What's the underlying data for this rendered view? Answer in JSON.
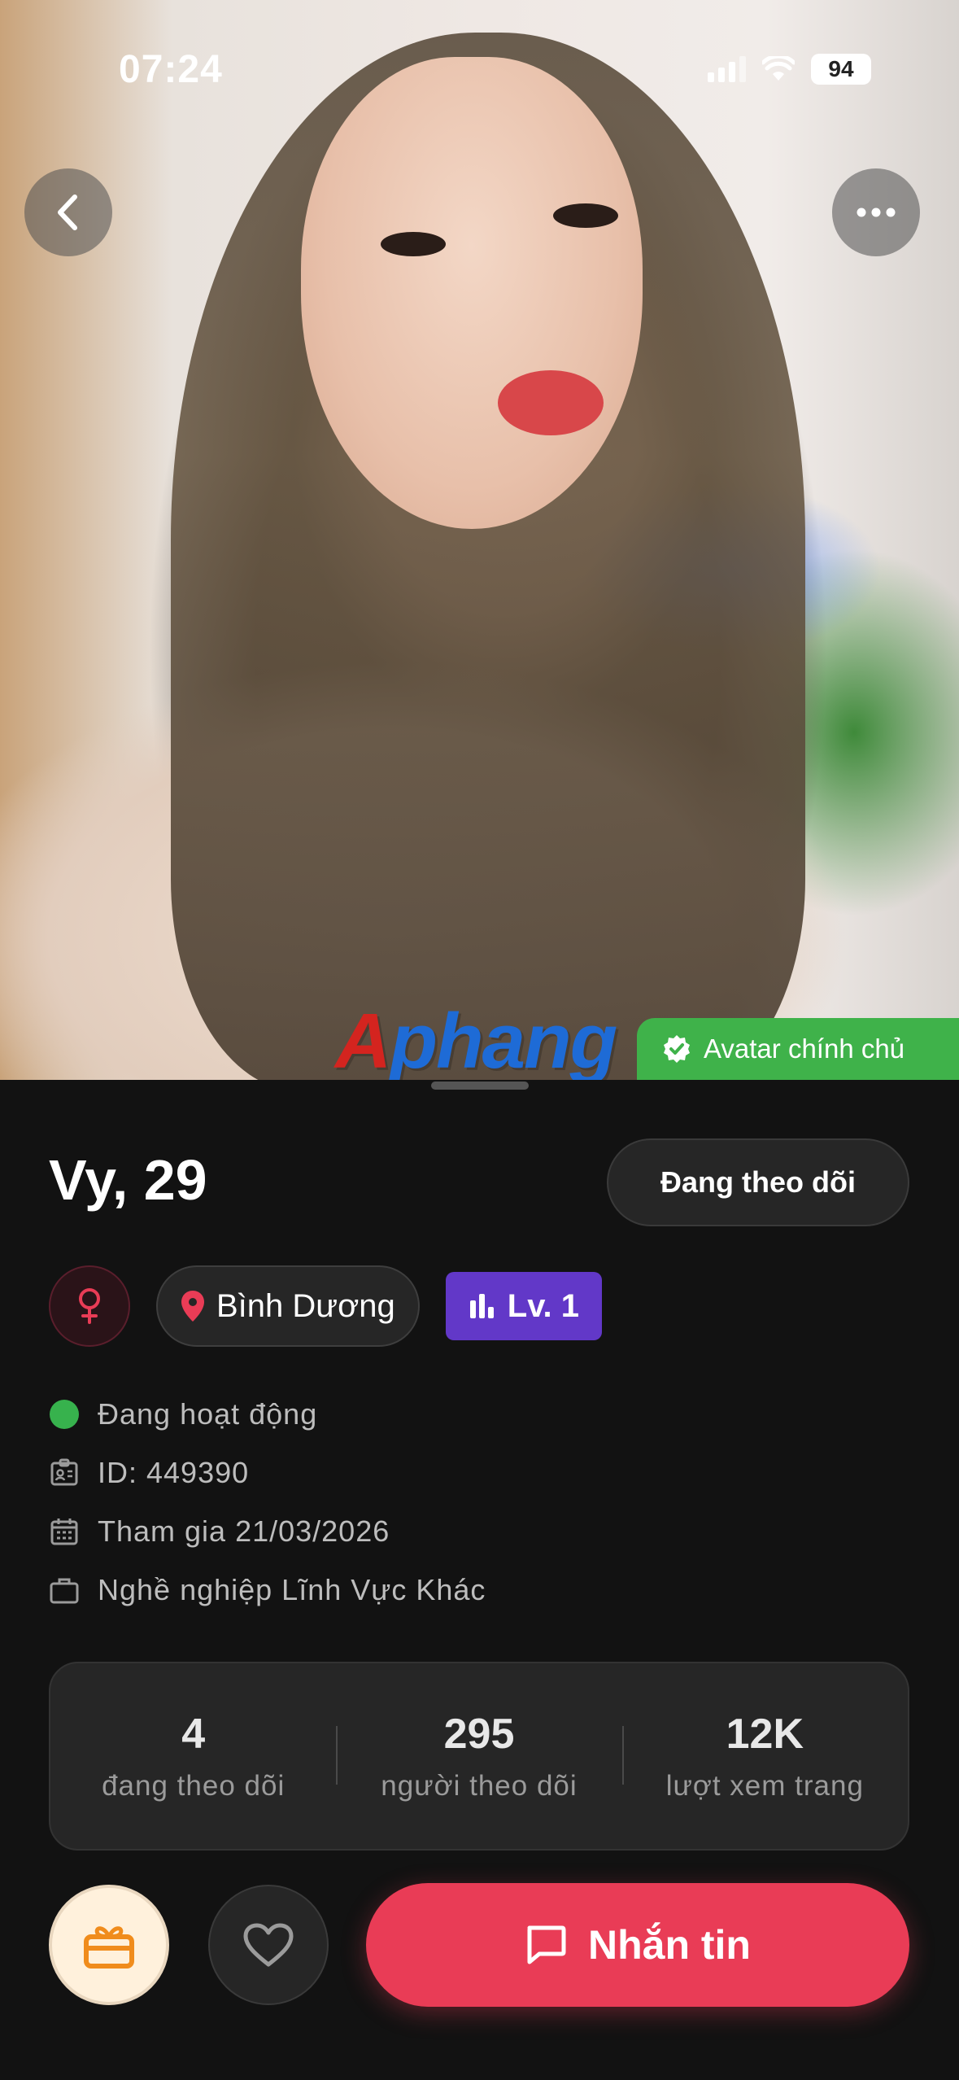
{
  "status_bar": {
    "time": "07:24",
    "battery": "94"
  },
  "hero": {
    "watermark": "Aphang",
    "verified_badge": "Avatar chính chủ"
  },
  "profile": {
    "name_age": "Vy, 29",
    "follow_button": "Đang theo dõi",
    "location": "Bình Dương",
    "level": "Lv. 1",
    "info": {
      "status": "Đang hoạt động",
      "id": "ID: 449390",
      "joined": "Tham gia 21/03/2026",
      "job": "Nghề nghiệp Lĩnh Vực Khác"
    },
    "stats": [
      {
        "value": "4",
        "label": "đang theo dõi"
      },
      {
        "value": "295",
        "label": "người theo dõi"
      },
      {
        "value": "12K",
        "label": "lượt xem trang"
      }
    ]
  },
  "actions": {
    "message_button": "Nhắn tin"
  },
  "colors": {
    "accent": "#e93c56",
    "verified": "#3fb24a",
    "level": "#6238c8",
    "online": "#37b24d",
    "background": "#121212"
  },
  "icons": [
    "back-icon",
    "more-icon",
    "check-badge-icon",
    "female-icon",
    "location-pin-icon",
    "bar-chart-icon",
    "id-card-icon",
    "calendar-icon",
    "briefcase-icon",
    "gift-icon",
    "heart-icon",
    "chat-icon"
  ]
}
